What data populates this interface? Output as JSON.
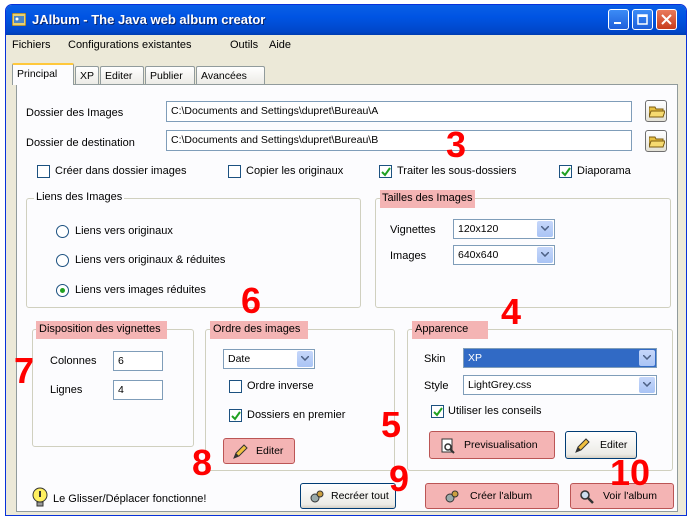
{
  "window": {
    "title": "JAlbum - The Java web album creator"
  },
  "menu": [
    "Fichiers",
    "Configurations existantes",
    "Outils",
    "Aide"
  ],
  "tabs": [
    "Principal",
    "XP",
    "Editer",
    "Publier",
    "Avancées"
  ],
  "paths": {
    "images_label": "Dossier des Images",
    "images_value": "C:\\Documents and Settings\\dupret\\Bureau\\A",
    "dest_label": "Dossier de destination",
    "dest_value": "C:\\Documents and Settings\\dupret\\Bureau\\B"
  },
  "options": {
    "create_in_images": "Créer dans dossier images",
    "copy_originals": "Copier les originaux",
    "subfolders": "Traiter les sous-dossiers",
    "slideshow": "Diaporama"
  },
  "links": {
    "legend": "Liens des Images",
    "opt1": "Liens vers originaux",
    "opt2": "Liens vers originaux & réduites",
    "opt3": "Liens vers images réduites"
  },
  "sizes": {
    "legend": "Tailles des Images",
    "thumbs_label": "Vignettes",
    "thumbs_value": "120x120",
    "images_label": "Images",
    "images_value": "640x640"
  },
  "layout_group": {
    "legend": "Disposition des vignettes",
    "cols_label": "Colonnes",
    "cols_value": "6",
    "rows_label": "Lignes",
    "rows_value": "4"
  },
  "order": {
    "legend": "Ordre des images",
    "sort_value": "Date",
    "reverse": "Ordre inverse",
    "folders_first": "Dossiers en premier",
    "edit": "Editer"
  },
  "appearance": {
    "legend": "Apparence",
    "skin_label": "Skin",
    "skin_value": "XP",
    "style_label": "Style",
    "style_value": "LightGrey.css",
    "hints": "Utiliser les conseils",
    "preview": "Previsualisation",
    "edit": "Editer"
  },
  "footer": {
    "hint": "Le Glisser/Déplacer fonctionne!",
    "rebuild": "Recréer tout",
    "create": "Créer l'album",
    "view": "Voir l'album"
  },
  "callouts": [
    "3",
    "4",
    "5",
    "6",
    "7",
    "8",
    "9",
    "10"
  ],
  "colors": {
    "highlight": "#F4B4B4",
    "callout": "#FF0000",
    "titlebar": "#0054E3"
  }
}
